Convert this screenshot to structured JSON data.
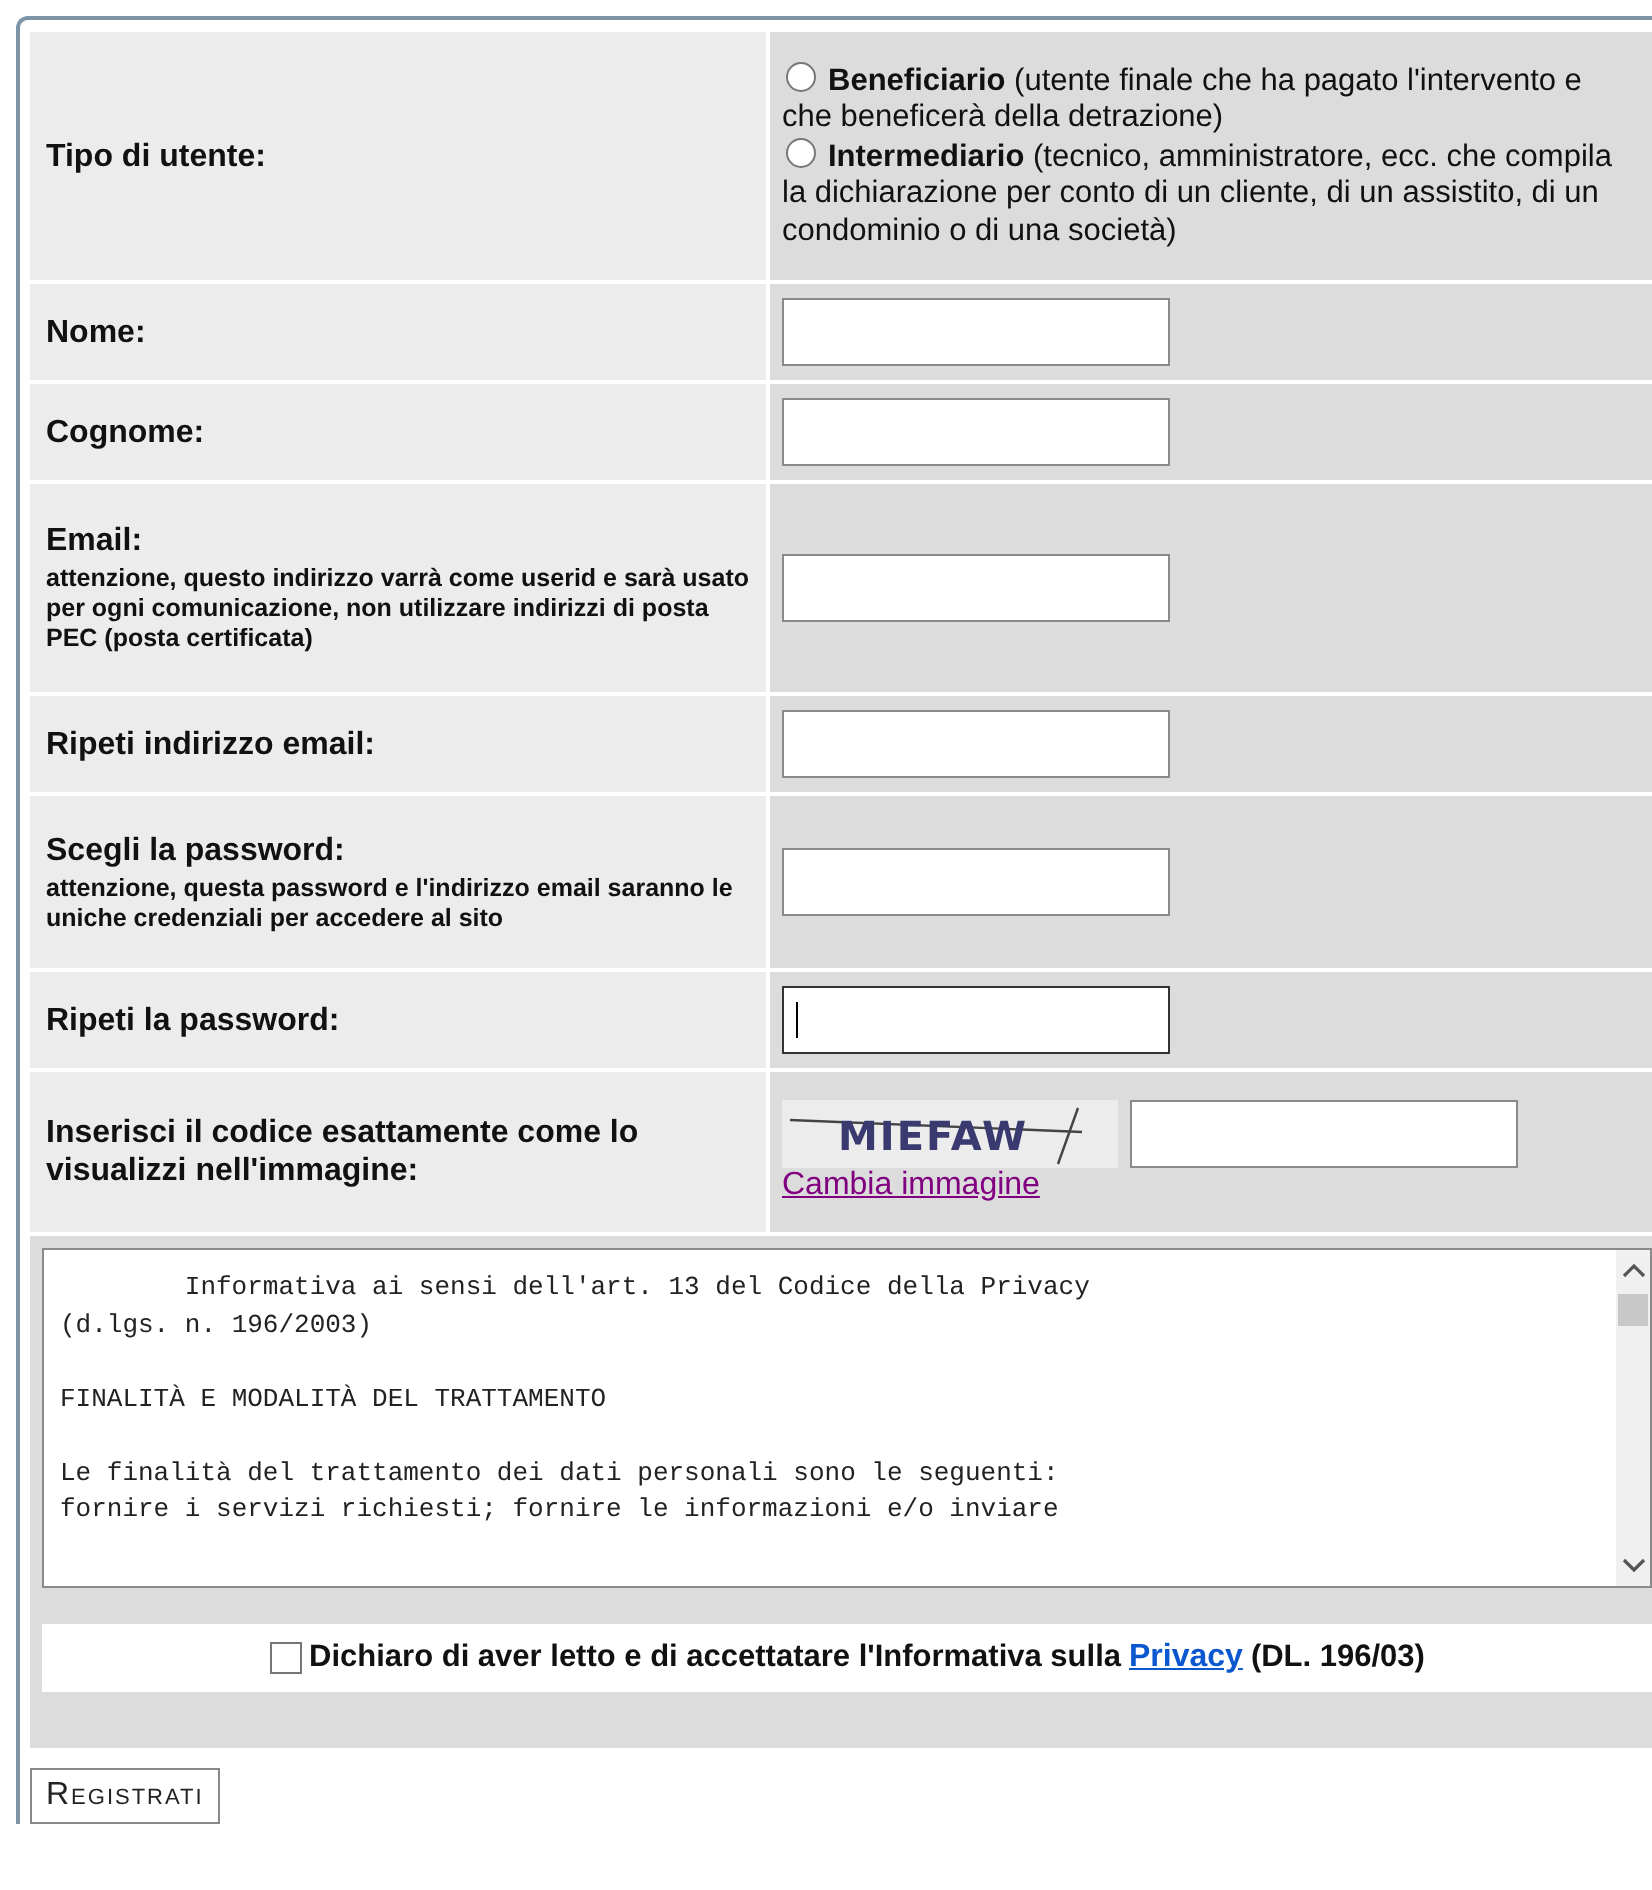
{
  "user_type": {
    "label": "Tipo di utente:",
    "options": [
      {
        "name": "Beneficiario",
        "description": "(utente finale che ha pagato l'intervento e che beneficerà della detrazione)",
        "selected": false
      },
      {
        "name": "Intermediario",
        "description": "(tecnico, amministratore, ecc. che compila la dichiarazione per conto di un cliente, di un assistito, di un condominio o di una società)",
        "selected": false
      }
    ]
  },
  "fields": [
    {
      "label": "Nome:",
      "focused": false
    },
    {
      "label": "Cognome:",
      "focused": false
    },
    {
      "label": "Email:",
      "note": "attenzione, questo indirizzo varrà come userid e sarà usato per ogni comunicazione, non utilizzare indirizzi di posta PEC (posta certificata)",
      "focused": false
    },
    {
      "label": "Ripeti indirizzo email:",
      "focused": false
    },
    {
      "label": "Scegli la password:",
      "note": "attenzione, questa password e l'indirizzo email saranno le uniche credenziali per accedere al sito",
      "focused": false
    },
    {
      "label": "Ripeti la password:",
      "focused": true
    }
  ],
  "captcha": {
    "label": "Inserisci il codice esattamente come lo visualizzi nell'immagine:",
    "image_text": "MIEFAW",
    "link": "Cambia immagine"
  },
  "privacy": {
    "paragraphs": [
      {
        "indented": true,
        "lines": [
          "Informativa ai sensi dell'art. 13 del Codice della Privacy",
          "(d.lgs. n. 196/2003)"
        ]
      },
      {
        "indented": false,
        "lines": [
          "FINALITÀ E MODALITÀ DEL TRATTAMENTO"
        ]
      },
      {
        "indented": false,
        "lines": [
          "Le finalità del trattamento dei dati personali sono le seguenti:",
          "fornire i servizi richiesti; fornire le informazioni e/o inviare"
        ]
      }
    ],
    "consent": {
      "checked": false,
      "before": "Dichiaro di aver letto e di accettatare l'Informativa sulla",
      "link": "Privacy",
      "after": "(DL. 196/03)"
    }
  },
  "submit": "Registrati"
}
